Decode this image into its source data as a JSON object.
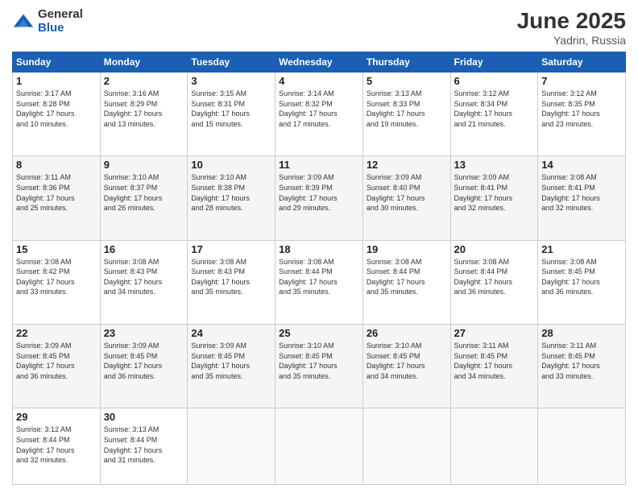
{
  "header": {
    "logo_general": "General",
    "logo_blue": "Blue",
    "month": "June 2025",
    "location": "Yadrin, Russia"
  },
  "weekdays": [
    "Sunday",
    "Monday",
    "Tuesday",
    "Wednesday",
    "Thursday",
    "Friday",
    "Saturday"
  ],
  "weeks": [
    [
      {
        "day": "1",
        "info": "Sunrise: 3:17 AM\nSunset: 8:28 PM\nDaylight: 17 hours\nand 10 minutes."
      },
      {
        "day": "2",
        "info": "Sunrise: 3:16 AM\nSunset: 8:29 PM\nDaylight: 17 hours\nand 13 minutes."
      },
      {
        "day": "3",
        "info": "Sunrise: 3:15 AM\nSunset: 8:31 PM\nDaylight: 17 hours\nand 15 minutes."
      },
      {
        "day": "4",
        "info": "Sunrise: 3:14 AM\nSunset: 8:32 PM\nDaylight: 17 hours\nand 17 minutes."
      },
      {
        "day": "5",
        "info": "Sunrise: 3:13 AM\nSunset: 8:33 PM\nDaylight: 17 hours\nand 19 minutes."
      },
      {
        "day": "6",
        "info": "Sunrise: 3:12 AM\nSunset: 8:34 PM\nDaylight: 17 hours\nand 21 minutes."
      },
      {
        "day": "7",
        "info": "Sunrise: 3:12 AM\nSunset: 8:35 PM\nDaylight: 17 hours\nand 23 minutes."
      }
    ],
    [
      {
        "day": "8",
        "info": "Sunrise: 3:11 AM\nSunset: 8:36 PM\nDaylight: 17 hours\nand 25 minutes."
      },
      {
        "day": "9",
        "info": "Sunrise: 3:10 AM\nSunset: 8:37 PM\nDaylight: 17 hours\nand 26 minutes."
      },
      {
        "day": "10",
        "info": "Sunrise: 3:10 AM\nSunset: 8:38 PM\nDaylight: 17 hours\nand 28 minutes."
      },
      {
        "day": "11",
        "info": "Sunrise: 3:09 AM\nSunset: 8:39 PM\nDaylight: 17 hours\nand 29 minutes."
      },
      {
        "day": "12",
        "info": "Sunrise: 3:09 AM\nSunset: 8:40 PM\nDaylight: 17 hours\nand 30 minutes."
      },
      {
        "day": "13",
        "info": "Sunrise: 3:09 AM\nSunset: 8:41 PM\nDaylight: 17 hours\nand 32 minutes."
      },
      {
        "day": "14",
        "info": "Sunrise: 3:08 AM\nSunset: 8:41 PM\nDaylight: 17 hours\nand 32 minutes."
      }
    ],
    [
      {
        "day": "15",
        "info": "Sunrise: 3:08 AM\nSunset: 8:42 PM\nDaylight: 17 hours\nand 33 minutes."
      },
      {
        "day": "16",
        "info": "Sunrise: 3:08 AM\nSunset: 8:43 PM\nDaylight: 17 hours\nand 34 minutes."
      },
      {
        "day": "17",
        "info": "Sunrise: 3:08 AM\nSunset: 8:43 PM\nDaylight: 17 hours\nand 35 minutes."
      },
      {
        "day": "18",
        "info": "Sunrise: 3:08 AM\nSunset: 8:44 PM\nDaylight: 17 hours\nand 35 minutes."
      },
      {
        "day": "19",
        "info": "Sunrise: 3:08 AM\nSunset: 8:44 PM\nDaylight: 17 hours\nand 35 minutes."
      },
      {
        "day": "20",
        "info": "Sunrise: 3:08 AM\nSunset: 8:44 PM\nDaylight: 17 hours\nand 36 minutes."
      },
      {
        "day": "21",
        "info": "Sunrise: 3:08 AM\nSunset: 8:45 PM\nDaylight: 17 hours\nand 36 minutes."
      }
    ],
    [
      {
        "day": "22",
        "info": "Sunrise: 3:09 AM\nSunset: 8:45 PM\nDaylight: 17 hours\nand 36 minutes."
      },
      {
        "day": "23",
        "info": "Sunrise: 3:09 AM\nSunset: 8:45 PM\nDaylight: 17 hours\nand 36 minutes."
      },
      {
        "day": "24",
        "info": "Sunrise: 3:09 AM\nSunset: 8:45 PM\nDaylight: 17 hours\nand 35 minutes."
      },
      {
        "day": "25",
        "info": "Sunrise: 3:10 AM\nSunset: 8:45 PM\nDaylight: 17 hours\nand 35 minutes."
      },
      {
        "day": "26",
        "info": "Sunrise: 3:10 AM\nSunset: 8:45 PM\nDaylight: 17 hours\nand 34 minutes."
      },
      {
        "day": "27",
        "info": "Sunrise: 3:11 AM\nSunset: 8:45 PM\nDaylight: 17 hours\nand 34 minutes."
      },
      {
        "day": "28",
        "info": "Sunrise: 3:11 AM\nSunset: 8:45 PM\nDaylight: 17 hours\nand 33 minutes."
      }
    ],
    [
      {
        "day": "29",
        "info": "Sunrise: 3:12 AM\nSunset: 8:44 PM\nDaylight: 17 hours\nand 32 minutes."
      },
      {
        "day": "30",
        "info": "Sunrise: 3:13 AM\nSunset: 8:44 PM\nDaylight: 17 hours\nand 31 minutes."
      },
      {
        "day": "",
        "info": ""
      },
      {
        "day": "",
        "info": ""
      },
      {
        "day": "",
        "info": ""
      },
      {
        "day": "",
        "info": ""
      },
      {
        "day": "",
        "info": ""
      }
    ]
  ]
}
